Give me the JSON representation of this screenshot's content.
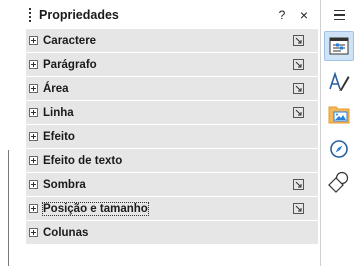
{
  "panel": {
    "title": "Propriedades",
    "help_glyph": "?",
    "close_glyph": "×"
  },
  "sections": [
    {
      "label": "Caractere",
      "has_more": true
    },
    {
      "label": "Parágrafo",
      "has_more": true
    },
    {
      "label": "Área",
      "has_more": true
    },
    {
      "label": "Linha",
      "has_more": true
    },
    {
      "label": "Efeito",
      "has_more": false
    },
    {
      "label": "Efeito de texto",
      "has_more": false
    },
    {
      "label": "Sombra",
      "has_more": true
    },
    {
      "label": "Posição e tamanho",
      "has_more": true
    },
    {
      "label": "Colunas",
      "has_more": false
    }
  ],
  "tabbar": {
    "menu_icon": "hamburger-menu-icon",
    "tabs": [
      {
        "icon": "properties-icon",
        "active": true
      },
      {
        "icon": "styles-icon",
        "active": false
      },
      {
        "icon": "gallery-icon",
        "active": false
      },
      {
        "icon": "navigator-icon",
        "active": false
      },
      {
        "icon": "shapes-icon",
        "active": false
      }
    ]
  },
  "colors": {
    "section_bg": "#e6e6e6",
    "active_tab_bg": "#cfe3f6",
    "accent_blue": "#2a7fd4",
    "gallery_orange": "#e89a2c"
  }
}
